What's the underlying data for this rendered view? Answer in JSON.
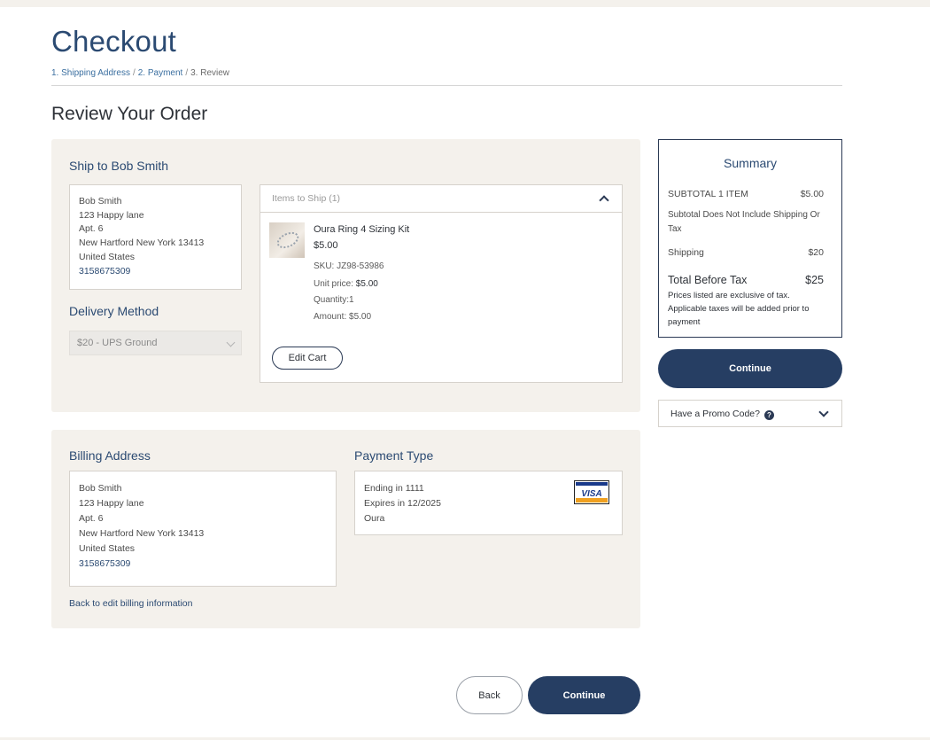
{
  "page": {
    "title": "Checkout",
    "breadcrumb": [
      {
        "label": "1. Shipping Address"
      },
      {
        "label": "2. Payment"
      },
      {
        "label": "3. Review"
      }
    ],
    "breadcrumb_sep": "/",
    "section_title": "Review Your Order"
  },
  "shipping": {
    "heading": "Ship to Bob Smith",
    "address": {
      "name": "Bob Smith",
      "line1": "123 Happy lane",
      "line2": "Apt. 6",
      "city_state_zip": "New Hartford New York 13413",
      "country": "United States",
      "phone": "3158675309"
    },
    "delivery_heading": "Delivery Method",
    "delivery_value": "$20 - UPS Ground"
  },
  "items": {
    "header": "Items to Ship (1)",
    "product": {
      "name": "Oura Ring 4 Sizing Kit",
      "price": "$5.00",
      "sku_label": "SKU:",
      "sku": "JZ98-53986",
      "unit_price_label": "Unit price:",
      "unit_price": "$5.00",
      "quantity_label": "Quantity:",
      "quantity": "1",
      "amount_label": "Amount:",
      "amount": "$5.00"
    },
    "edit_cart_label": "Edit Cart"
  },
  "billing": {
    "heading": "Billing Address",
    "address": {
      "name": "Bob Smith",
      "line1": "123 Happy lane",
      "line2": "Apt. 6",
      "city_state_zip": "New Hartford New York 13413",
      "country": "United States",
      "phone": "3158675309"
    },
    "back_link": "Back to edit billing information"
  },
  "payment": {
    "heading": "Payment Type",
    "ending": "Ending in 1111",
    "expires": "Expires in 12/2025",
    "holder": "Oura",
    "card_brand": "VISA",
    "card_colors": {
      "blue": "#1a3a8a",
      "gold": "#f0a020"
    }
  },
  "summary": {
    "title": "Summary",
    "subtotal_label": "SUBTOTAL 1 ITEM",
    "subtotal_value": "$5.00",
    "subtotal_note": "Subtotal Does Not Include Shipping Or Tax",
    "shipping_label": "Shipping",
    "shipping_value": "$20",
    "total_label": "Total Before Tax",
    "total_value": "$25",
    "tax_note": "Prices listed are exclusive of tax. Applicable taxes will be added prior to payment",
    "continue_label": "Continue"
  },
  "promo": {
    "label": "Have a Promo Code?",
    "help_glyph": "?"
  },
  "footer": {
    "back_label": "Back",
    "continue_label": "Continue"
  },
  "colors": {
    "primary": "#263e63",
    "panel": "#f4f1ec",
    "link": "#3b6fa0"
  }
}
